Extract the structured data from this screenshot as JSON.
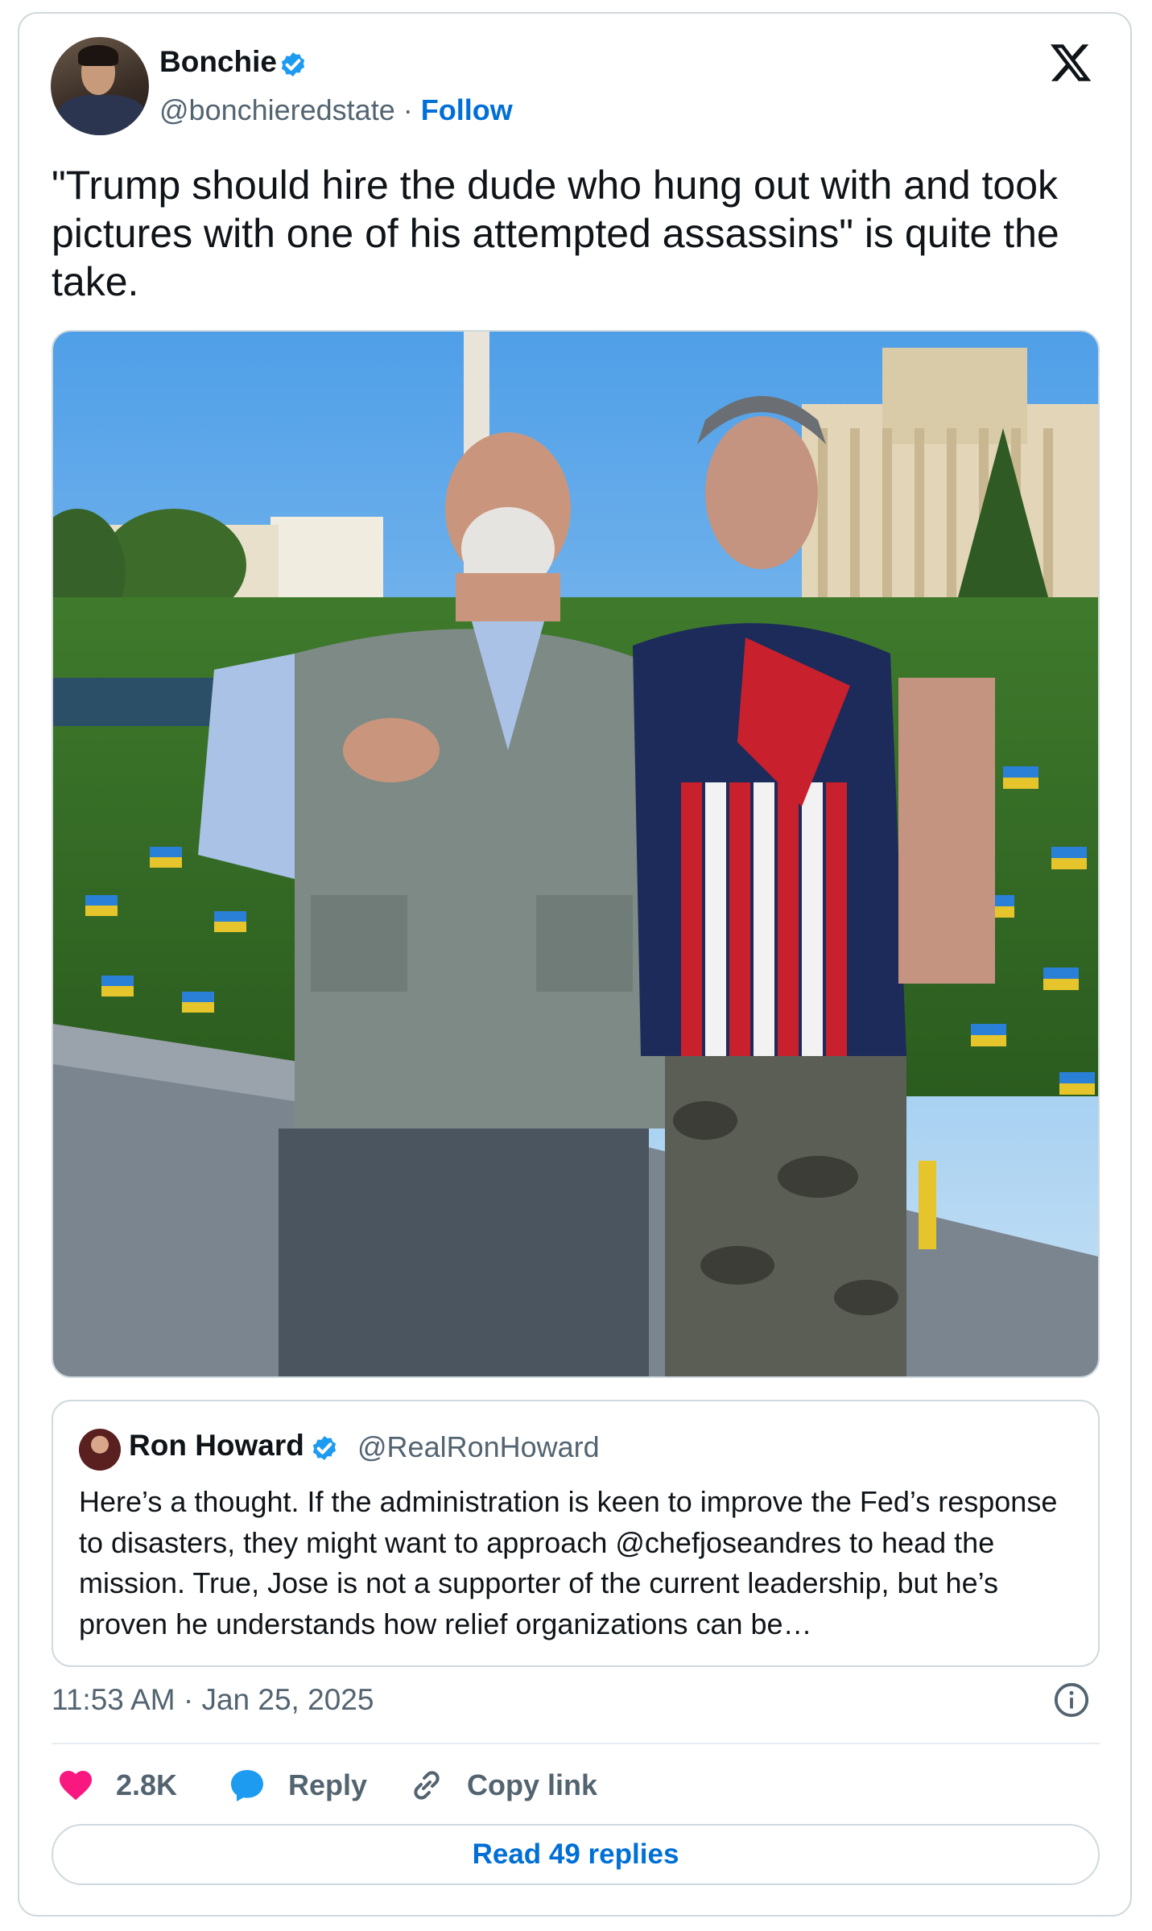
{
  "author": {
    "name": "Bonchie",
    "handle": "@bonchieredstate",
    "separator": "·",
    "follow_label": "Follow",
    "verified": true
  },
  "tweet": {
    "text": "\"Trump should hire the dude who hung out with and took pictures with one of his attempted assassins\" is quite the take."
  },
  "quoted_tweet": {
    "name": "Ron Howard",
    "handle": "@RealRonHoward",
    "verified": true,
    "text": "Here’s a thought. If the administration is keen to improve the Fed’s response to disasters, they might want to approach @chefjoseandres to head the mission. True, Jose is not a supporter of the current leadership, but he’s proven he understands how relief organizations can be…"
  },
  "meta": {
    "timestamp": "11:53 AM · Jan 25, 2025"
  },
  "actions": {
    "like_count": "2.8K",
    "reply_label": "Reply",
    "copy_link_label": "Copy link"
  },
  "read_replies_label": "Read 49 replies",
  "icons": {
    "platform": "x-logo-icon",
    "verified": "verified-badge-icon",
    "info": "info-icon",
    "like": "heart-icon",
    "reply": "speech-bubble-icon",
    "link": "link-icon"
  },
  "colors": {
    "accent_blue": "#006fd6",
    "verified_blue": "#1d9bf0",
    "like_pink": "#f91880",
    "secondary_text": "#536471",
    "border": "#cfd9de"
  }
}
